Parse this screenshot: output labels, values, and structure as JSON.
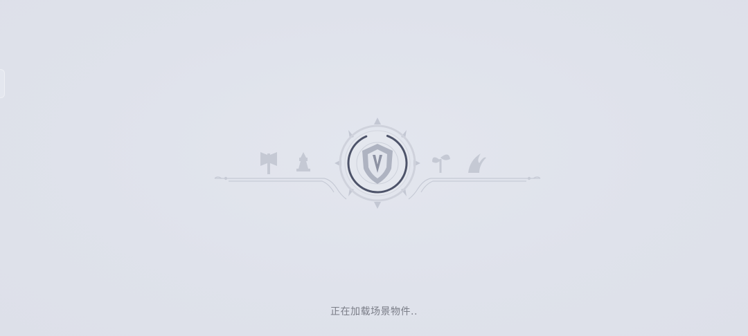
{
  "loading": {
    "status_text": "正在加载场景物件..",
    "progress": 0.3
  },
  "icons": {
    "left": [
      "axe-icon",
      "tower-icon"
    ],
    "center": "shield-emblem-icon",
    "right": [
      "sprout-icon",
      "flame-wing-icon"
    ]
  },
  "colors": {
    "background": "#dfe2eb",
    "ornament": "#c3c7d3",
    "progress_ring": "#4d5369",
    "text": "#7b7e88"
  }
}
